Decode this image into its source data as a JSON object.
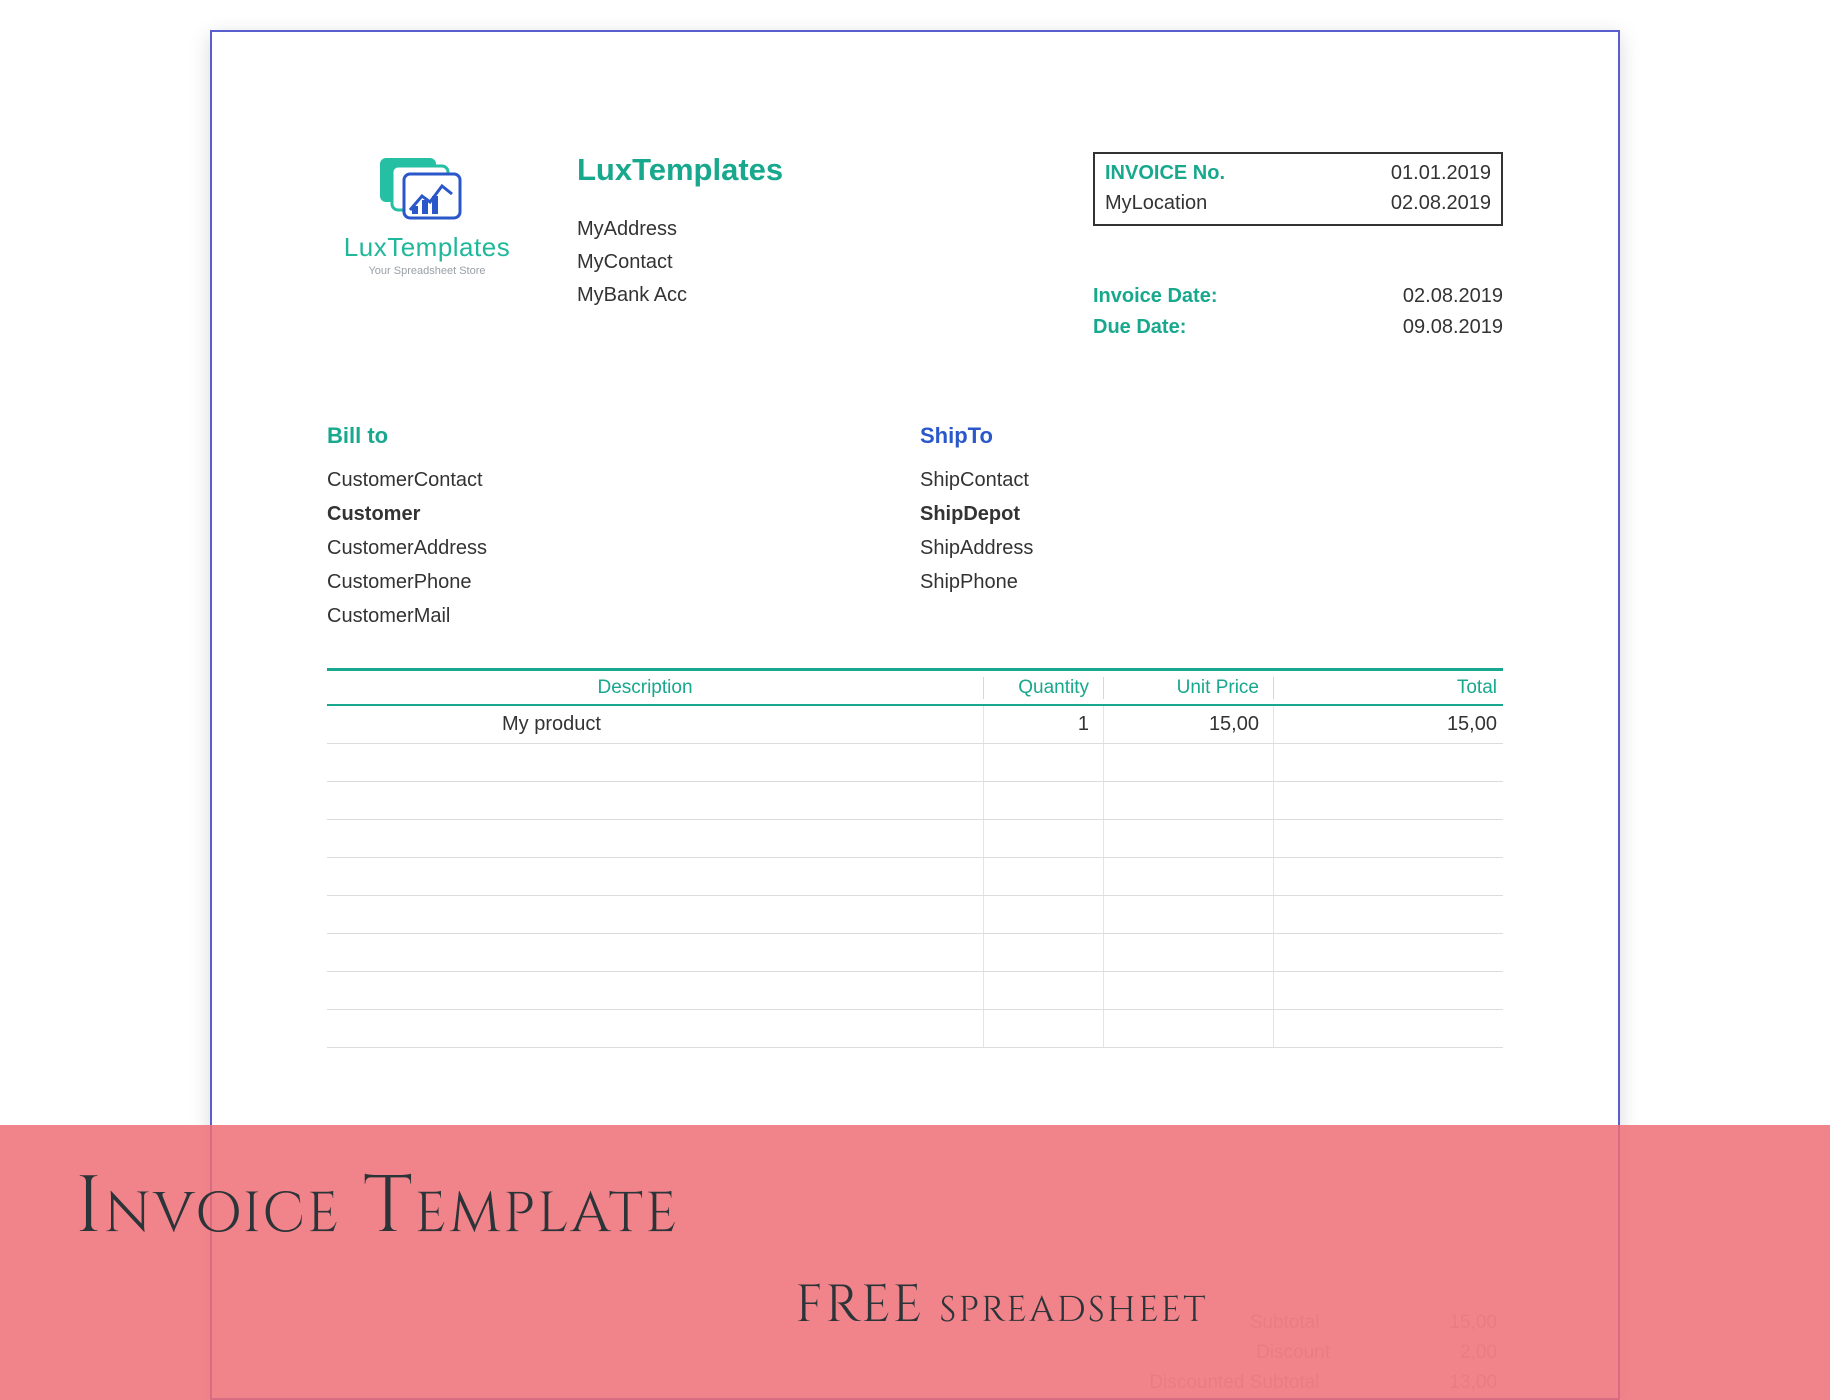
{
  "logo": {
    "brand": "LuxTemplates",
    "tagline": "Your Spreadsheet Store"
  },
  "company": {
    "name": "LuxTemplates",
    "address": "MyAddress",
    "contact": "MyContact",
    "bank": "MyBank Acc"
  },
  "invoice_box": {
    "label_no": "INVOICE No.",
    "value_no": "01.01.2019",
    "label_loc": "MyLocation",
    "value_loc": "02.08.2019"
  },
  "dates": {
    "label_invoice": "Invoice Date:",
    "value_invoice": "02.08.2019",
    "label_due": "Due Date:",
    "value_due": "09.08.2019"
  },
  "bill_to": {
    "heading": "Bill to",
    "contact": "CustomerContact",
    "name": "Customer",
    "address": "CustomerAddress",
    "phone": "CustomerPhone",
    "mail": "CustomerMail"
  },
  "ship_to": {
    "heading": "ShipTo",
    "contact": "ShipContact",
    "name": "ShipDepot",
    "address": "ShipAddress",
    "phone": "ShipPhone"
  },
  "table": {
    "headers": {
      "desc": "Description",
      "qty": "Quantity",
      "unit": "Unit Price",
      "total": "Total"
    },
    "rows": [
      {
        "desc": "My product",
        "qty": "1",
        "unit": "15,00",
        "total": "15,00"
      }
    ],
    "empty_rows": 8
  },
  "faded": {
    "subtotal_label": "Subtotal",
    "subtotal_value": "15,00",
    "discount_label": "Discount",
    "discount_value": "2,00",
    "dsub_label": "Discounted Subtotal",
    "dsub_value": "13,00"
  },
  "banner": {
    "title": "Invoice Template",
    "subtitle": "FREE spreadsheet"
  },
  "colors": {
    "accent": "#18a88d",
    "link": "#2a57c9",
    "banner": "#ee6e76"
  }
}
